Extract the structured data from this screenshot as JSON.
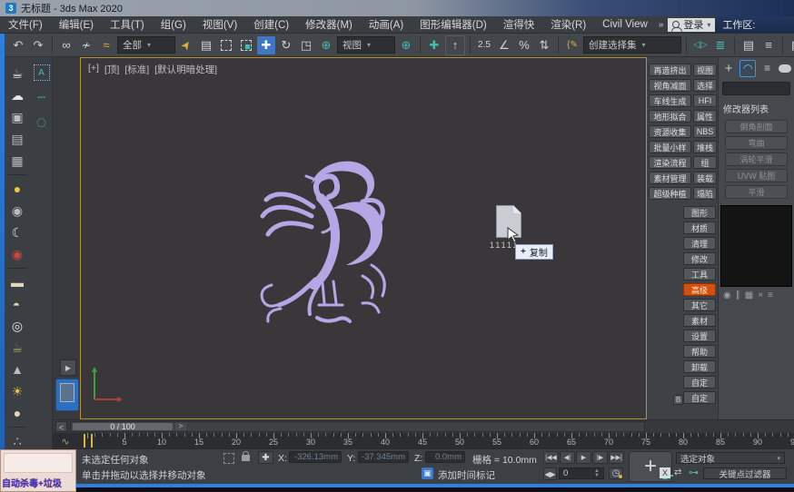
{
  "titlebar": {
    "title": "无标题 - 3ds Max 2020",
    "app_badge": "3"
  },
  "menubar": {
    "items": [
      "文件(F)",
      "编辑(E)",
      "工具(T)",
      "组(G)",
      "视图(V)",
      "创建(C)",
      "修改器(M)",
      "动画(A)",
      "图形编辑器(D)",
      "渲得快",
      "渲染(R)",
      "Civil View"
    ],
    "overflow": "»",
    "login": "登录",
    "workspace": "工作区:"
  },
  "toolbar": {
    "selection_filter": "全部",
    "ref_coord": "视图",
    "named_selection": "创建选择集"
  },
  "icons": {
    "undo": "↶",
    "redo": "↷",
    "link": "∞",
    "unlink": "≁",
    "bind_spacewarp": "≈",
    "select": "➤",
    "select_by_name": "▤",
    "move": "✚",
    "rotate": "↻",
    "scale": "◳",
    "pivot": "⊕",
    "manipulate": "✚",
    "kbd_override": "↑",
    "snap": "2.5",
    "angle_snap": "∠",
    "percent_snap": "%",
    "spinner_snap": "⇅",
    "named_sel_edit": "{✎",
    "mirror": "◁▷",
    "align": "≣",
    "scene_explorer": "▤",
    "layer_explorer": "≡",
    "ribbon": "▦",
    "curve_editor": "∿",
    "teapot": "☕",
    "cloud": "☁",
    "render_setup": "▣",
    "frame_window": "▤",
    "environment": "▦",
    "bulb": "●",
    "camera_speaker": "◉",
    "moon": "☾",
    "video_camera": "◉",
    "area_light": "▬",
    "dome_light": "◖",
    "ring_light": "◎",
    "teapot2": "☕",
    "cone": "▲",
    "sun": "☀",
    "sphere": "●",
    "scatter": "∴",
    "sel_a": "A",
    "dash_line": "┄",
    "dash_circle": "◌",
    "layout_arrow": "▶",
    "slider_prev": "<",
    "slider_next": ">",
    "mini_curve": "∿",
    "playback": [
      "|◀◀",
      "◀|",
      "▶",
      "|▶",
      "▶▶|"
    ],
    "frame_fwd": "◀▶",
    "key_clock": "◷",
    "spin_up": "▲",
    "spin_down": "▼",
    "create_tab": "+",
    "modify_tab": "◠",
    "hierarchy_tab": "≡",
    "motion_tab": "◎",
    "stack_tools": [
      "◉",
      "∥",
      "▦",
      "×",
      "≡"
    ],
    "xyz_typein": "✚",
    "swap": "⇄",
    "key_filter_ico": "⊶",
    "time_tag_ico": "▣",
    "set_keys_plus": "+",
    "tooltip_plus": "+",
    "dropdown_arrow": "▾",
    "workspace_icon": "▦"
  },
  "viewport": {
    "label_plus": "[+]",
    "label_view": "[顶]",
    "label_standard": "[标准]",
    "label_shading": "[默认明暗处理]",
    "drag_file_name": "11111",
    "tooltip_text": "复制"
  },
  "plugin_panel": {
    "grid": [
      [
        "再造挤出",
        "视图"
      ],
      [
        "视角减面",
        "选择"
      ],
      [
        "车线生成",
        "HFI"
      ],
      [
        "地形拟合",
        "属性"
      ],
      [
        "资源收集",
        "NBS"
      ],
      [
        "批量小样",
        "堆栈"
      ],
      [
        "渲染流程",
        "组"
      ],
      [
        "素材管理",
        "装载"
      ],
      [
        "超级种植",
        "塌陷"
      ]
    ],
    "column": [
      {
        "label": "图形"
      },
      {
        "label": "材质"
      },
      {
        "label": "清理"
      },
      {
        "label": "修改"
      },
      {
        "label": "工具"
      },
      {
        "label": "高级",
        "active": true
      },
      {
        "label": "其它"
      },
      {
        "label": "素材"
      },
      {
        "label": "设置"
      },
      {
        "label": "帮助"
      },
      {
        "label": "卸载"
      },
      {
        "label": "自定"
      },
      {
        "label": "自定"
      }
    ],
    "badge": "B"
  },
  "command_panel": {
    "modifier_list": "修改器列表",
    "presets": [
      "倒角剖面",
      "弯曲",
      "涡轮平滑",
      "UVW 贴图",
      "平滑"
    ]
  },
  "time": {
    "slider_value": "0 / 100",
    "frame": "0"
  },
  "timeline": {
    "max": 100,
    "label_step": 5
  },
  "statusbar": {
    "selection_status": "未选定任何对象",
    "prompt": "单击并拖动以选择并移动对象",
    "x_label": "X:",
    "x_value": "-326.13mm",
    "y_label": "Y:",
    "y_value": "-37.345mm",
    "z_label": "Z:",
    "z_value": "0.0mm",
    "grid_label": "栅格 = 10.0mm",
    "add_time_tag": "添加时间标记",
    "selected_dropdown": "选定对象",
    "key_filters": "关键点过滤器",
    "close_x": "X"
  },
  "ad": {
    "text": "自动杀毒+垃圾"
  },
  "colors": {
    "accent_blue": "#3e78c2",
    "active_orange": "#d4500e",
    "viewport_border": "#b5952f",
    "phoenix": "#b7a6e6"
  }
}
